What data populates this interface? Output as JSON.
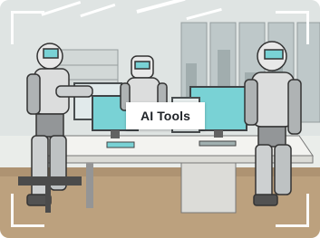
{
  "card": {
    "label": "AI Tools",
    "illustration_icon": "robots-office-illustration",
    "accent": "#6ecfd2",
    "frame_color": "#ffffff"
  }
}
